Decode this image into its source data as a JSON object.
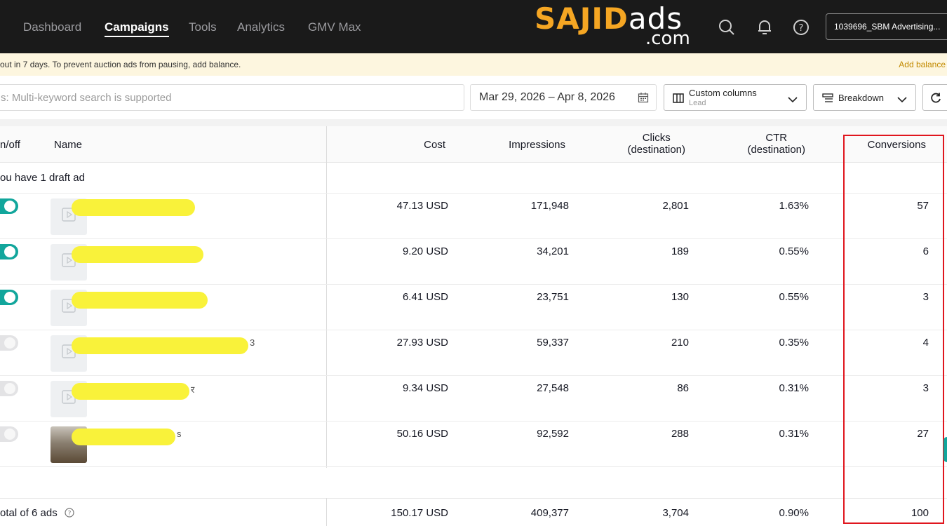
{
  "nav": {
    "items": [
      "Dashboard",
      "Campaigns",
      "Tools",
      "Analytics",
      "GMV Max"
    ],
    "active": "Campaigns"
  },
  "logo": {
    "brand_accent": "SAJID",
    "brand_rest": "ads",
    "domain": ".com"
  },
  "account": {
    "label": "1039696_SBM Advertising..."
  },
  "banner": {
    "text": "out in 7 days. To prevent auction ads from pausing, add balance.",
    "link": "Add balance"
  },
  "toolbar": {
    "search_placeholder": "s: Multi-keyword search is supported",
    "date_range": "Mar 29, 2026  –  Apr 8, 2026",
    "custom_columns_label": "Custom columns",
    "custom_columns_value": "Lead",
    "breakdown_label": "Breakdown"
  },
  "table": {
    "headers": {
      "onoff": "n/off",
      "name": "Name",
      "cost": "Cost",
      "impressions": "Impressions",
      "clicks_1": "Clicks",
      "clicks_2": "(destination)",
      "ctr_1": "CTR",
      "ctr_2": "(destination)",
      "conversions": "Conversions"
    },
    "draft_note": "ou have 1 draft ad",
    "rows": [
      {
        "on": true,
        "cost": "47.13 USD",
        "impressions": "171,948",
        "clicks": "2,801",
        "ctr": "1.63%",
        "conversions": "57",
        "name_tail": ""
      },
      {
        "on": true,
        "cost": "9.20 USD",
        "impressions": "34,201",
        "clicks": "189",
        "ctr": "0.55%",
        "conversions": "6",
        "name_tail": ""
      },
      {
        "on": true,
        "cost": "6.41 USD",
        "impressions": "23,751",
        "clicks": "130",
        "ctr": "0.55%",
        "conversions": "3",
        "name_tail": ""
      },
      {
        "on": false,
        "cost": "27.93 USD",
        "impressions": "59,337",
        "clicks": "210",
        "ctr": "0.35%",
        "conversions": "4",
        "name_tail": "3"
      },
      {
        "on": false,
        "cost": "9.34 USD",
        "impressions": "27,548",
        "clicks": "86",
        "ctr": "0.31%",
        "conversions": "3",
        "name_tail": "र"
      },
      {
        "on": false,
        "cost": "50.16 USD",
        "impressions": "92,592",
        "clicks": "288",
        "ctr": "0.31%",
        "conversions": "27",
        "name_tail": "s"
      }
    ],
    "total": {
      "label": "otal of 6 ads",
      "cost": "150.17 USD",
      "impressions": "409,377",
      "clicks": "3,704",
      "ctr": "0.90%",
      "conversions": "100"
    }
  },
  "colors": {
    "topbar": "#1a1a1a",
    "accent_logo": "#f5a623",
    "toggle_on": "#12a69c",
    "highlight_box": "#e0161e",
    "redaction": "#f9f23a"
  }
}
